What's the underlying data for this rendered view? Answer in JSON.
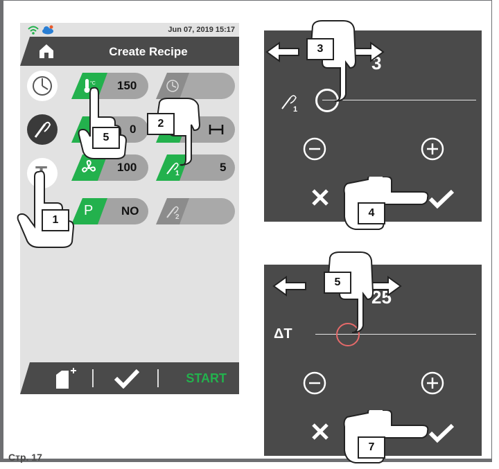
{
  "status": {
    "datetime": "Jun 07, 2019  15:17"
  },
  "header": {
    "title": "Create Recipe"
  },
  "program_rows": [
    {
      "value": "150"
    },
    {
      "value": "0"
    },
    {
      "value": "100"
    },
    {
      "value": "NO"
    }
  ],
  "right_column": {
    "probe_value": "5"
  },
  "bottom_bar": {
    "start_label": "START"
  },
  "panel_top": {
    "value_partial": "3"
  },
  "panel_bottom": {
    "value_partial": "25"
  },
  "step_badges": {
    "b1": "1",
    "b2": "2",
    "b3": "3",
    "b4": "4",
    "b5a": "5",
    "b5b": "5",
    "b7": "7"
  },
  "icons": {
    "p_label": "P",
    "t_label": "T",
    "delta_t_label": "ΔT",
    "probe_1_sub": "1",
    "probe_2_sub": "2"
  },
  "footer": {
    "page": "Стр. 17"
  },
  "colors": {
    "accent_green": "#23b14d",
    "panel_dark": "#4a4a4a",
    "screen_bg": "#e2e2e2"
  }
}
